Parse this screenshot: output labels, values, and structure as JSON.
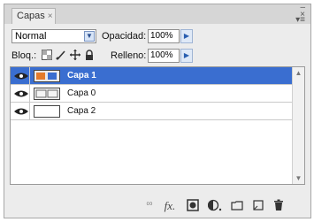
{
  "panel": {
    "tab_label": "Capas",
    "tab_close": "×",
    "window_controls": "- ×",
    "panel_menu_icon": "menu-icon"
  },
  "options": {
    "blend_mode": "Normal",
    "opacity_label": "Opacidad:",
    "opacity_value": "100%",
    "lock_label": "Bloq.:",
    "fill_label": "Relleno:",
    "fill_value": "100%"
  },
  "layers": [
    {
      "name": "Capa 1",
      "selected": true
    },
    {
      "name": "Capa 0",
      "selected": false
    },
    {
      "name": "Capa 2",
      "selected": false
    }
  ],
  "bottom_icons": [
    "link-icon",
    "fx-icon",
    "mask-icon",
    "adjustment-icon",
    "group-icon",
    "new-layer-icon",
    "trash-icon"
  ],
  "colors": {
    "selected_row": "#3a6ed0",
    "panel_bg": "#ececec"
  }
}
